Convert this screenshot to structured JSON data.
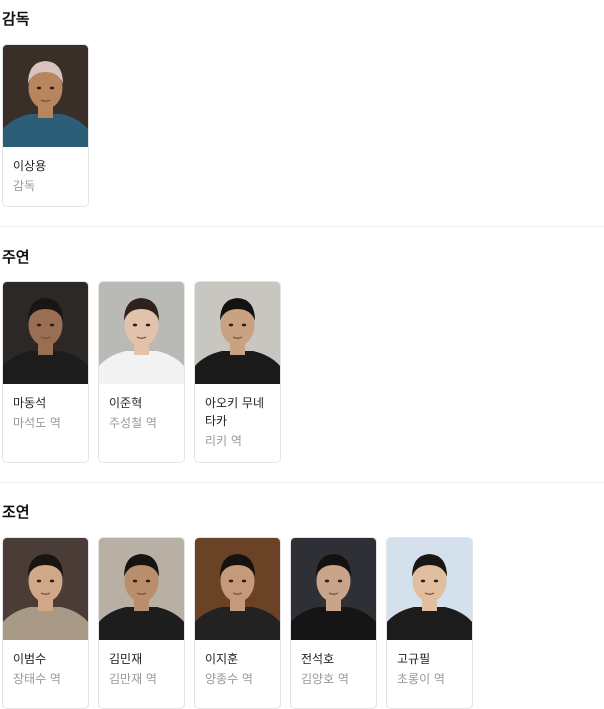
{
  "sections": [
    {
      "title": "감독",
      "people": [
        {
          "name": "이상용",
          "role": "감독",
          "bg": "#3a2e28",
          "skin": "#b8865e",
          "hair": "#d9c3c0",
          "cloth": "#2c5e78"
        }
      ]
    },
    {
      "title": "주연",
      "people": [
        {
          "name": "마동석",
          "role": "마석도 역",
          "bg": "#2b2825",
          "skin": "#9a6e52",
          "hair": "#1a1512",
          "cloth": "#1c1c1c"
        },
        {
          "name": "이준혁",
          "role": "주성철 역",
          "bg": "#b9b9b6",
          "skin": "#e2c2aa",
          "hair": "#2d221d",
          "cloth": "#f2f2f2"
        },
        {
          "name": "아오키 무네타카",
          "role": "리키 역",
          "bg": "#c8c6c0",
          "skin": "#c9a282",
          "hair": "#141210",
          "cloth": "#1a1a1a"
        }
      ]
    },
    {
      "title": "조연",
      "people": [
        {
          "name": "이범수",
          "role": "장태수 역",
          "bg": "#4a3c36",
          "skin": "#d0a888",
          "hair": "#1a1512",
          "cloth": "#a89a86"
        },
        {
          "name": "김민재",
          "role": "김만재 역",
          "bg": "#b8b0a4",
          "skin": "#b88e6c",
          "hair": "#171310",
          "cloth": "#1d1d1d"
        },
        {
          "name": "이지훈",
          "role": "양종수 역",
          "bg": "#6a4226",
          "skin": "#c49a7a",
          "hair": "#161210",
          "cloth": "#222222"
        },
        {
          "name": "전석호",
          "role": "김양호 역",
          "bg": "#2e3036",
          "skin": "#c8a48a",
          "hair": "#141210",
          "cloth": "#151515"
        },
        {
          "name": "고규필",
          "role": "초롱이 역",
          "bg": "#d4e0ec",
          "skin": "#e2bea0",
          "hair": "#1a1614",
          "cloth": "#1c1c1c"
        }
      ]
    }
  ]
}
